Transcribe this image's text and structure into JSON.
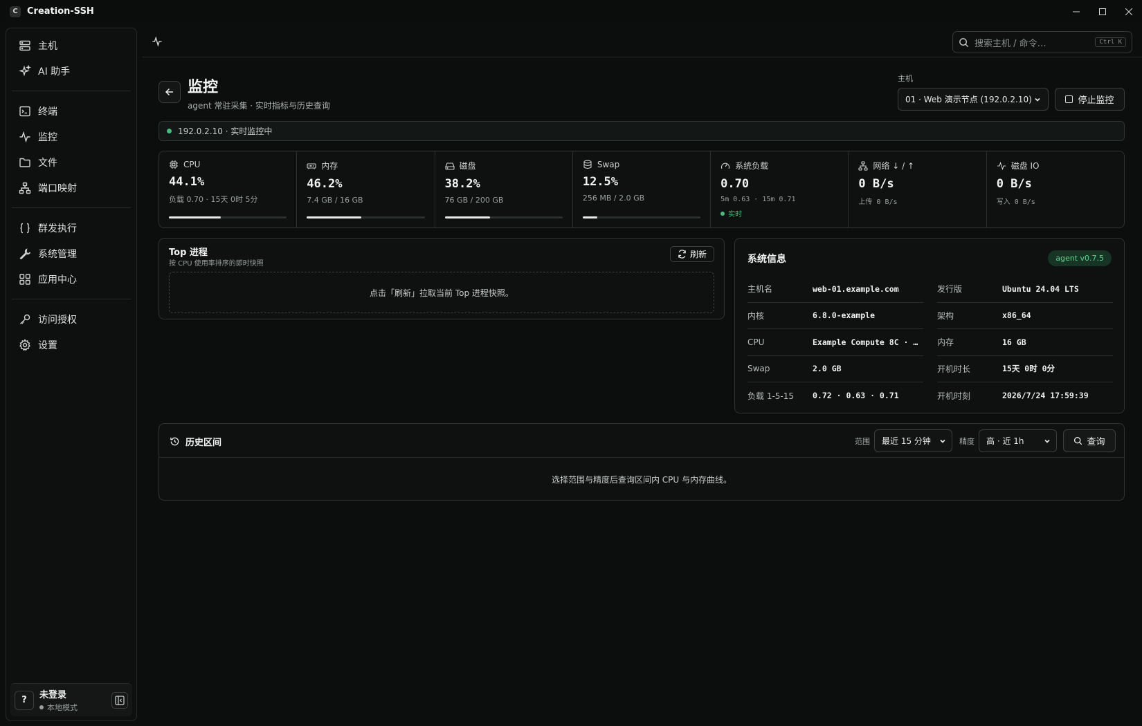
{
  "app": {
    "title": "Creation-SSH",
    "logo": "C"
  },
  "sidebar": {
    "groups": [
      [
        {
          "label": "主机",
          "icon": "server-icon"
        },
        {
          "label": "AI 助手",
          "icon": "sparkles-icon"
        }
      ],
      [
        {
          "label": "终端",
          "icon": "terminal-icon"
        },
        {
          "label": "监控",
          "icon": "activity-icon"
        },
        {
          "label": "文件",
          "icon": "folder-icon"
        },
        {
          "label": "端口映射",
          "icon": "network-icon"
        }
      ],
      [
        {
          "label": "群发执行",
          "icon": "braces-icon"
        },
        {
          "label": "系统管理",
          "icon": "wrench-icon"
        },
        {
          "label": "应用中心",
          "icon": "grid-icon"
        }
      ],
      [
        {
          "label": "访问授权",
          "icon": "key-icon"
        },
        {
          "label": "设置",
          "icon": "gear-icon"
        }
      ]
    ],
    "user": {
      "avatar": "?",
      "name": "未登录",
      "mode": "本地模式"
    }
  },
  "search": {
    "placeholder": "搜索主机 / 命令…",
    "shortcut": "Ctrl K"
  },
  "page": {
    "title": "监控",
    "subtitle": "agent 常驻采集 · 实时指标与历史查询",
    "host_label": "主机",
    "host_value": "01 · Web 演示节点 (192.0.2.10)",
    "stop_label": "停止监控",
    "status": "192.0.2.10 · 实时监控中"
  },
  "metrics": {
    "cpu": {
      "label": "CPU",
      "value": "44.1%",
      "sub": "负载 0.70 · 15天 0时 5分",
      "percent": 44.1
    },
    "mem": {
      "label": "内存",
      "value": "46.2%",
      "sub": "7.4 GB / 16 GB",
      "percent": 46.2
    },
    "disk": {
      "label": "磁盘",
      "value": "38.2%",
      "sub": "76 GB / 200 GB",
      "percent": 38.2
    },
    "swap": {
      "label": "Swap",
      "value": "12.5%",
      "sub": "256 MB / 2.0 GB",
      "percent": 12.5
    },
    "load": {
      "label": "系统负载",
      "value": "0.70",
      "sub": "5m 0.63 · 15m 0.71",
      "live": "实时"
    },
    "net": {
      "label": "网络 ↓ / ↑",
      "value": "0 B/s",
      "sub": "上传 0 B/s"
    },
    "diskio": {
      "label": "磁盘 IO",
      "value": "0 B/s",
      "sub": "写入 0 B/s"
    }
  },
  "top_process": {
    "title": "Top 进程",
    "subtitle": "按 CPU 使用率排序的即时快照",
    "refresh_label": "刷新",
    "empty": "点击「刷新」拉取当前 Top 进程快照。"
  },
  "sysinfo": {
    "title": "系统信息",
    "agent": "agent v0.7.5",
    "rows": [
      {
        "key": "主机名",
        "value": "web-01.example.com"
      },
      {
        "key": "发行版",
        "value": "Ubuntu 24.04 LTS"
      },
      {
        "key": "内核",
        "value": "6.8.0-example"
      },
      {
        "key": "架构",
        "value": "x86_64"
      },
      {
        "key": "CPU",
        "value": "Example Compute 8C · …"
      },
      {
        "key": "内存",
        "value": "16 GB"
      },
      {
        "key": "Swap",
        "value": "2.0 GB"
      },
      {
        "key": "开机时长",
        "value": "15天 0时 0分"
      },
      {
        "key": "负载 1-5-15",
        "value": "0.72 · 0.63 · 0.71"
      },
      {
        "key": "开机时刻",
        "value": "2026/7/24 17:59:39"
      }
    ]
  },
  "history": {
    "title": "历史区间",
    "range_label": "范围",
    "range_value": "最近 15 分钟",
    "precision_label": "精度",
    "precision_value": "高 · 近 1h",
    "query_label": "查询",
    "empty": "选择范围与精度后查询区间内 CPU 与内存曲线。"
  },
  "colors": {
    "accent_green": "#3ec07a",
    "background": "#0c0e0d",
    "border": "#2f3431"
  }
}
